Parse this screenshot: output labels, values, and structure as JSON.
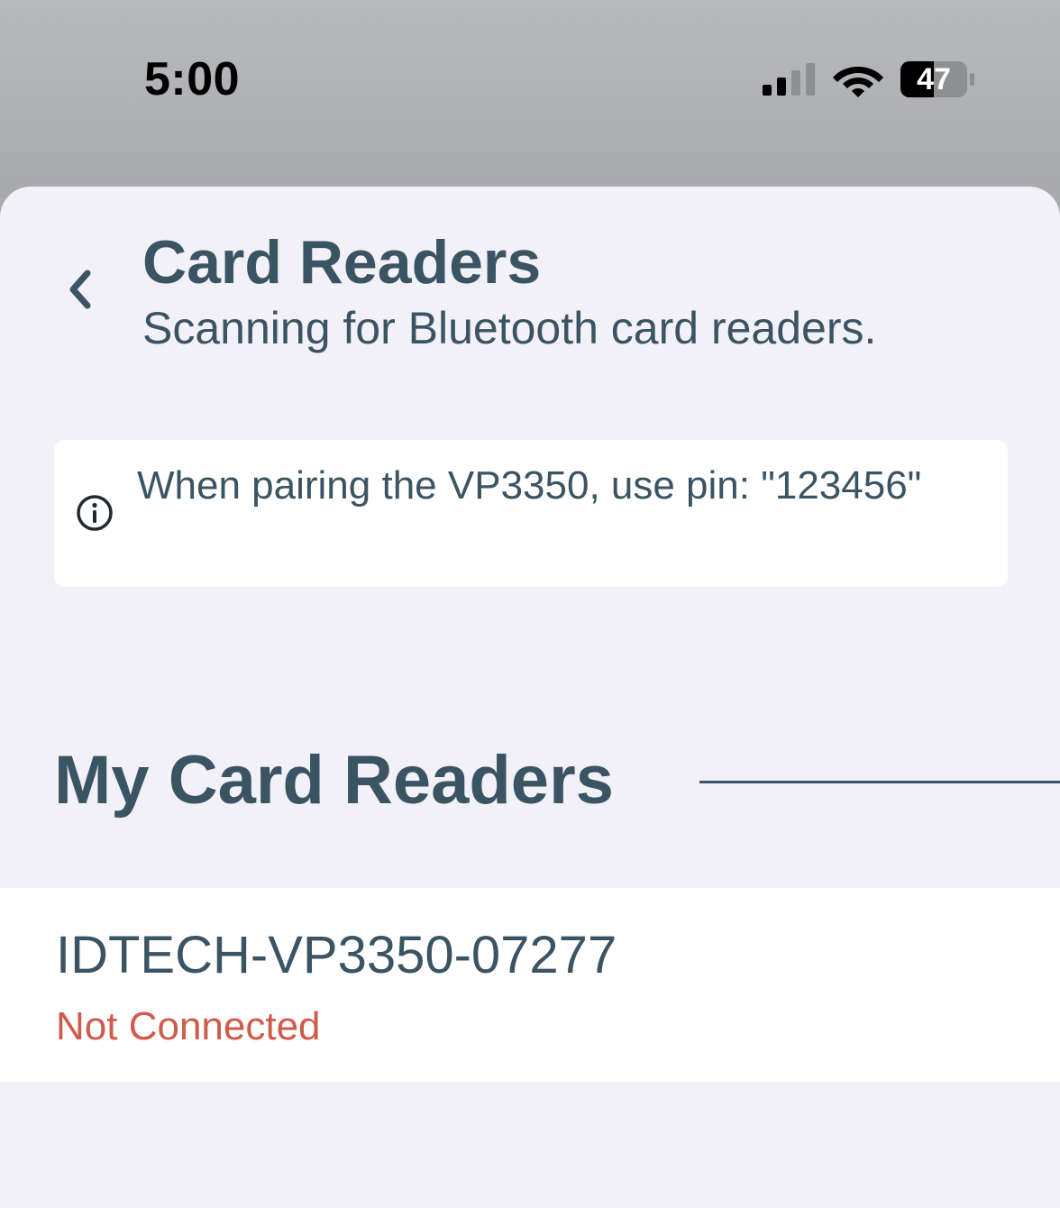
{
  "status_bar": {
    "time": "5:00",
    "battery_level": "47",
    "icons": [
      "signal-icon",
      "wifi-icon",
      "battery-icon"
    ]
  },
  "header": {
    "title": "Card Readers",
    "subtitle": "Scanning for Bluetooth card readers.",
    "back_icon": "chevron-left-icon"
  },
  "info_banner": {
    "icon": "info-icon",
    "text": "When pairing the VP3350, use pin: \"123456\""
  },
  "section": {
    "title": "My Card Readers"
  },
  "readers": [
    {
      "name": "IDTECH-VP3350-07277",
      "status": "Not Connected"
    }
  ],
  "colors": {
    "text_primary": "#3b5463",
    "status_error": "#d05a4b",
    "sheet_background": "#f2f1f7",
    "card_background": "#ffffff"
  }
}
